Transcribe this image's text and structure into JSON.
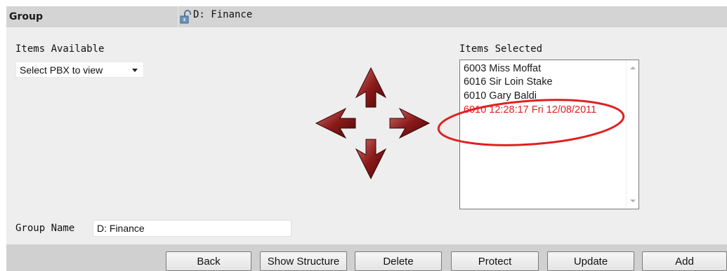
{
  "header": {
    "title": "Group",
    "group_name": "D: Finance"
  },
  "items_available": {
    "label": "Items Available",
    "select_value": "Select PBX to view"
  },
  "items_selected": {
    "label": "Items Selected",
    "items": [
      {
        "text": "6003 Miss Moffat"
      },
      {
        "text": "6016 Sir Loin Stake"
      },
      {
        "text": "6010 Gary Baldi"
      },
      {
        "text": "6010 12:28:17 Fri 12/08/2011"
      }
    ]
  },
  "group_name_field": {
    "label": "Group Name",
    "value": "D: Finance"
  },
  "buttons": {
    "back": "Back",
    "show_structure": "Show Structure",
    "delete": "Delete",
    "protect": "Protect",
    "update": "Update",
    "add": "Add"
  },
  "colors": {
    "arrow": "#8b1a1a",
    "highlight": "#e02020",
    "header_bg": "#d4d4d4",
    "panel_bg": "#eeeeee"
  },
  "icons": {
    "arrows": [
      "arrow-up-icon",
      "arrow-left-icon",
      "arrow-right-icon",
      "arrow-down-icon"
    ],
    "lock": "unlocked-padlock-icon"
  }
}
